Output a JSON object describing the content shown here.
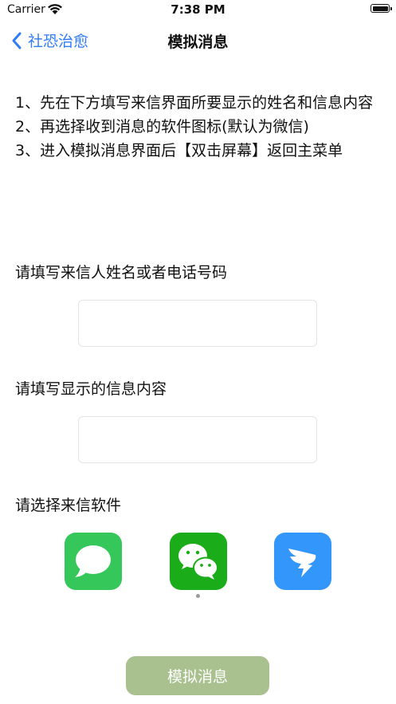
{
  "status_bar": {
    "carrier": "Carrier",
    "time": "7:38 PM"
  },
  "nav": {
    "back_label": "社恐治愈",
    "title": "模拟消息"
  },
  "instructions": [
    "1、先在下方填写来信界面所要显示的姓名和信息内容",
    "2、再选择收到消息的软件图标(默认为微信)",
    "3、进入模拟消息界面后【双击屏幕】返回主菜单"
  ],
  "form": {
    "name_label": "请填写来信人姓名或者电话号码",
    "name_value": "",
    "content_label": "请填写显示的信息内容",
    "content_value": "",
    "app_label": "请选择来信软件"
  },
  "apps": [
    {
      "icon": "messages-icon",
      "color": "#35c759"
    },
    {
      "icon": "wechat-icon",
      "color": "#1aad19",
      "selected": true
    },
    {
      "icon": "dingtalk-icon",
      "color": "#3296fa"
    }
  ],
  "submit_label": "模拟消息",
  "colors": {
    "accent": "#2f7cf6",
    "button": "#a9c08f"
  }
}
